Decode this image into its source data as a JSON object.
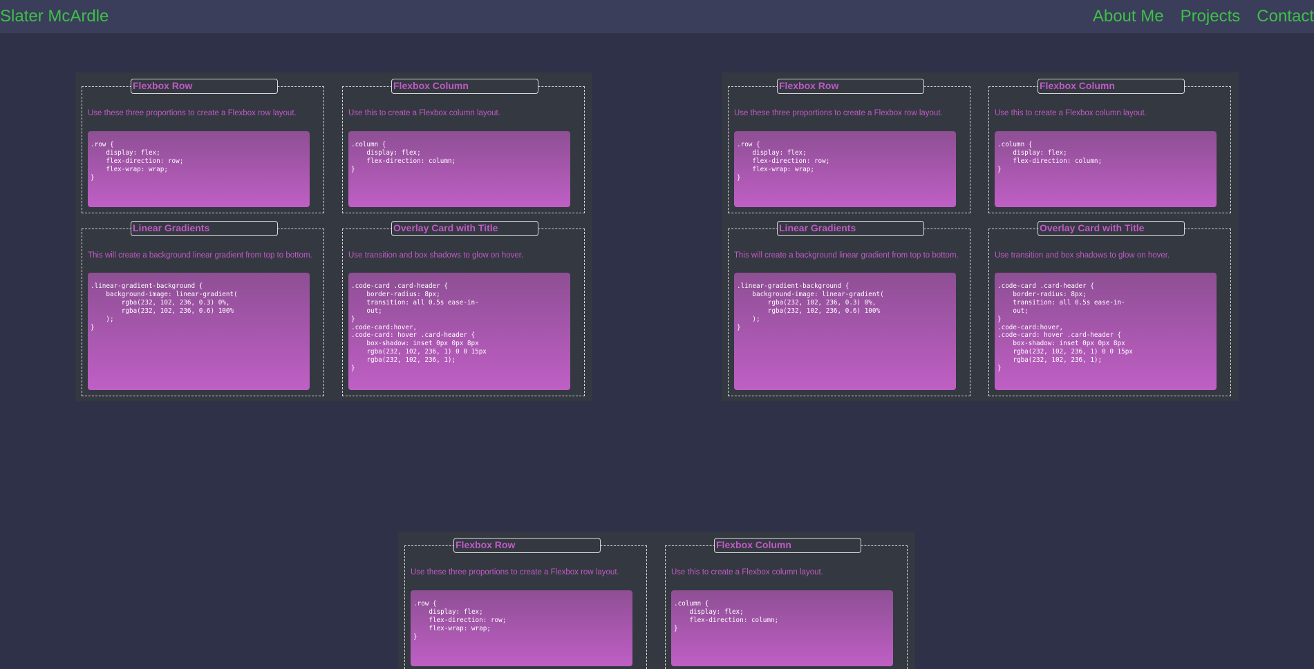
{
  "nav": {
    "brand": "Slater McArdle",
    "links": [
      "About Me",
      "Projects",
      "Contact"
    ]
  },
  "cards": {
    "flex_row": {
      "title": "Flexbox Row",
      "desc": "Use these three proportions to create a Flexbox row layout.",
      "code": ".row {\n    display: flex;\n    flex-direction: row;\n    flex-wrap: wrap;\n}"
    },
    "flex_column": {
      "title": "Flexbox Column",
      "desc": "Use this to create a Flexbox column layout.",
      "code": ".column {\n    display: flex;\n    flex-direction: column;\n}"
    },
    "linear_gradients": {
      "title": "Linear Gradients",
      "desc": "This will create a background linear gradient from top to bottom.",
      "code": ".linear-gradient-background {\n    background-image: linear-gradient(\n        rgba(232, 102, 236, 0.3) 0%,\n        rgba(232, 102, 236, 0.6) 100%\n    );\n}"
    },
    "overlay_card": {
      "title": "Overlay Card with Title",
      "desc": "Use transition and box shadows to glow on hover.",
      "code": ".code-card .card-header {\n    border-radius: 8px;\n    transition: all 0.5s ease-in-\n    out;\n}\n.code-card:hover,\n.code-card: hover .card-header {\n    box-shadow: inset 0px 0px 8px\n    rgba(232, 102, 236, 1) 0 0 15px\n    rgba(232, 102, 236, 1);\n}"
    }
  },
  "colors": {
    "background": "#2e3148",
    "navbar": "#3a3e5a",
    "nav_text": "#3fbf4a",
    "panel": "#343840",
    "accent": "#c05ac7",
    "gradient_top": "#8e4f94",
    "gradient_bottom": "#bf5fc5"
  }
}
